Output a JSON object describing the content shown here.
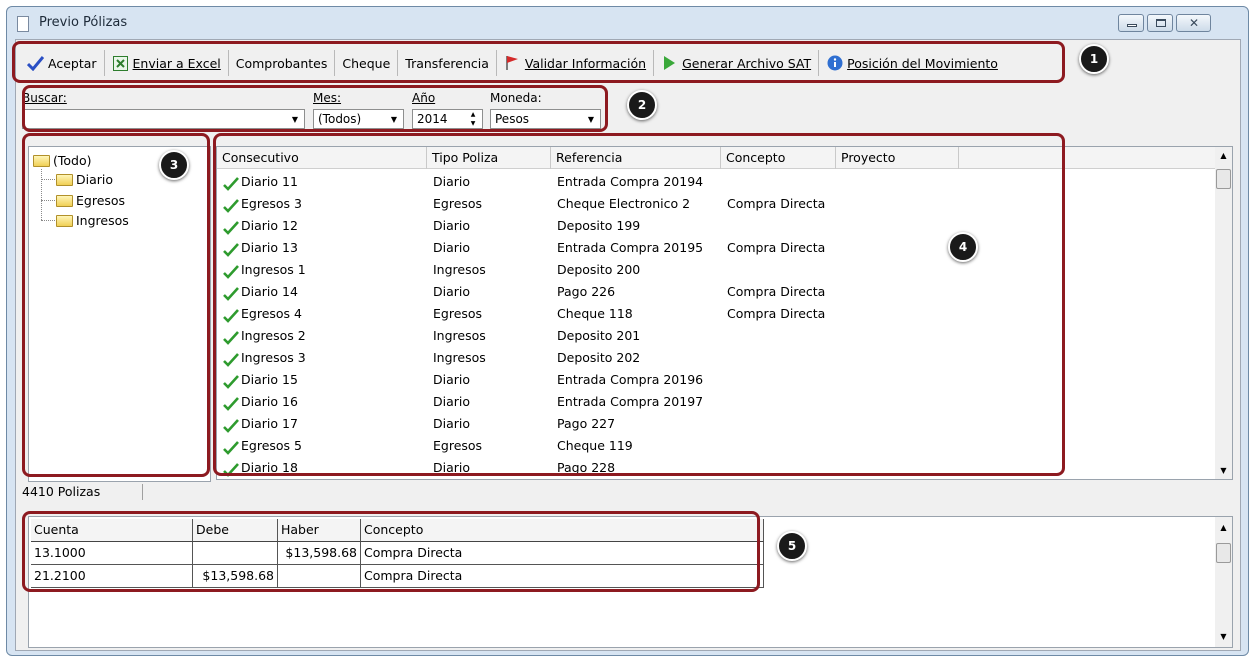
{
  "window": {
    "title": "Previo Pólizas"
  },
  "toolbar": {
    "aceptar": "Aceptar",
    "enviar_excel": "Enviar a Excel",
    "comprobantes": "Comprobantes",
    "cheque": "Cheque",
    "transferencia": "Transferencia",
    "validar": "Validar Información",
    "generar_sat": "Generar Archivo SAT",
    "posicion": "Posición del Movimiento"
  },
  "filters": {
    "buscar_label": "Buscar:",
    "buscar_value": "",
    "mes_label": "Mes:",
    "mes_value": "(Todos)",
    "anio_label": "Año",
    "anio_value": "2014",
    "moneda_label": "Moneda:",
    "moneda_value": "Pesos"
  },
  "tree": {
    "root": "(Todo)",
    "children": [
      "Diario",
      "Egresos",
      "Ingresos"
    ]
  },
  "polizas": {
    "columns": [
      "Consecutivo",
      "Tipo Poliza",
      "Referencia",
      "Concepto",
      "Proyecto"
    ],
    "rows": [
      [
        "Diario 11",
        "Diario",
        "Entrada Compra 20194",
        "",
        ""
      ],
      [
        "Egresos 3",
        "Egresos",
        "Cheque Electronico 2",
        "Compra Directa",
        ""
      ],
      [
        "Diario 12",
        "Diario",
        "Deposito 199",
        "",
        ""
      ],
      [
        "Diario 13",
        "Diario",
        "Entrada Compra 20195",
        "Compra Directa",
        ""
      ],
      [
        "Ingresos 1",
        "Ingresos",
        "Deposito 200",
        "",
        ""
      ],
      [
        "Diario 14",
        "Diario",
        "Pago 226",
        "Compra Directa",
        ""
      ],
      [
        "Egresos 4",
        "Egresos",
        "Cheque 118",
        "Compra Directa",
        ""
      ],
      [
        "Ingresos 2",
        "Ingresos",
        "Deposito 201",
        "",
        ""
      ],
      [
        "Ingresos 3",
        "Ingresos",
        "Deposito 202",
        "",
        ""
      ],
      [
        "Diario 15",
        "Diario",
        "Entrada Compra 20196",
        "",
        ""
      ],
      [
        "Diario 16",
        "Diario",
        "Entrada Compra 20197",
        "",
        ""
      ],
      [
        "Diario 17",
        "Diario",
        "Pago 227",
        "",
        ""
      ],
      [
        "Egresos 5",
        "Egresos",
        "Cheque 119",
        "",
        ""
      ],
      [
        "Diario 18",
        "Diario",
        "Pago 228",
        "",
        ""
      ]
    ]
  },
  "status": {
    "count": "4410 Polizas"
  },
  "detalle": {
    "columns": [
      "Cuenta",
      "Debe",
      "Haber",
      "Concepto"
    ],
    "rows": [
      [
        "13.1000",
        "",
        "$13,598.68",
        "Compra Directa"
      ],
      [
        "21.2100",
        "$13,598.68",
        "",
        "Compra Directa"
      ]
    ]
  },
  "callouts": [
    "1",
    "2",
    "3",
    "4",
    "5"
  ],
  "colors": {
    "callout_border": "#8d1a20",
    "badge": "#1a1a1a",
    "check": "#2e9b2e"
  }
}
